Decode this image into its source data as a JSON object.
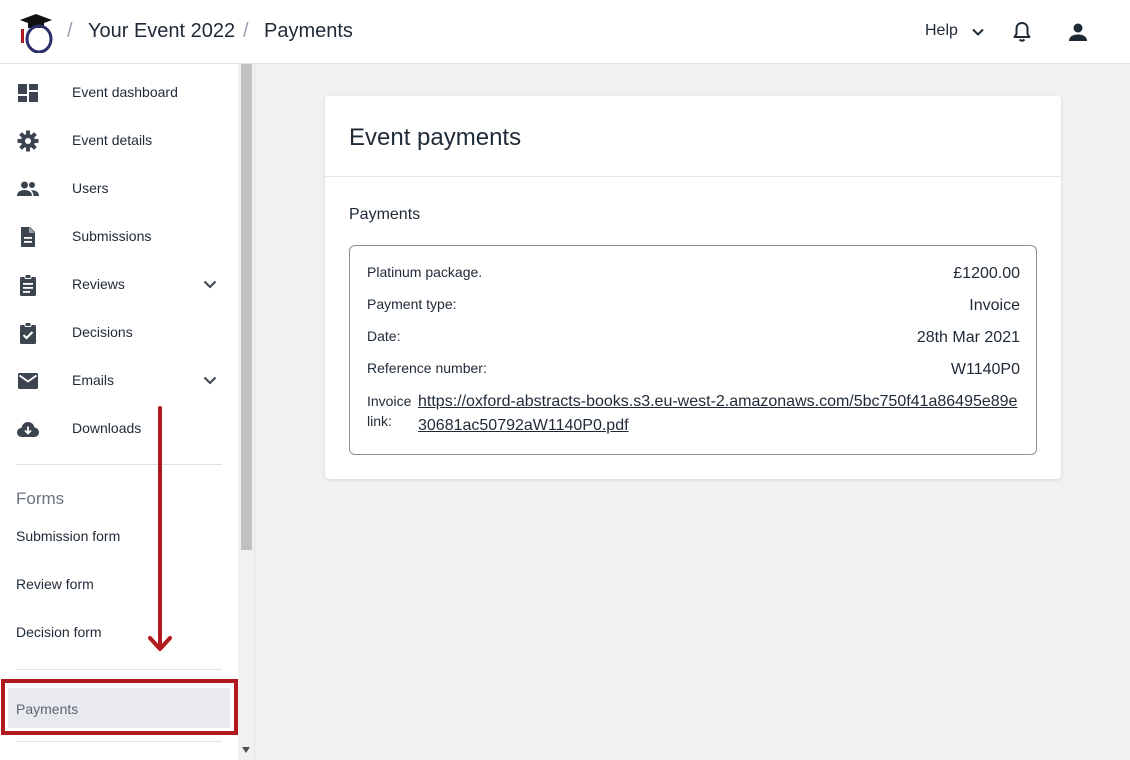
{
  "header": {
    "breadcrumb": [
      "Your Event 2022",
      "Payments"
    ],
    "help_label": "Help"
  },
  "sidebar": {
    "items": [
      {
        "label": "Event dashboard",
        "icon": "dashboard-icon"
      },
      {
        "label": "Event details",
        "icon": "gear-icon"
      },
      {
        "label": "Users",
        "icon": "users-icon"
      },
      {
        "label": "Submissions",
        "icon": "document-icon"
      },
      {
        "label": "Reviews",
        "icon": "clipboard-icon",
        "expandable": true
      },
      {
        "label": "Decisions",
        "icon": "clipboard-check-icon"
      },
      {
        "label": "Emails",
        "icon": "mail-icon",
        "expandable": true
      },
      {
        "label": "Downloads",
        "icon": "cloud-download-icon"
      }
    ],
    "forms_heading": "Forms",
    "forms": [
      "Submission form",
      "Review form",
      "Decision form"
    ],
    "active_item": "Payments"
  },
  "main": {
    "card_title": "Event payments",
    "section_title": "Payments",
    "payment": {
      "package_label": "Platinum package.",
      "package_value": "£1200.00",
      "type_label": "Payment type:",
      "type_value": "Invoice",
      "date_label": "Date:",
      "date_value": "28th Mar 2021",
      "ref_label": "Reference number:",
      "ref_value": "W1140P0",
      "link_label": "Invoice link:",
      "link_value": "https://oxford-abstracts-books.s3.eu-west-2.amazonaws.com/5bc750f41a86495e89e30681ac50792aW1140P0.pdf"
    }
  },
  "colors": {
    "annotation_red": "#b0191e",
    "logo_navy": "#2b2f6b",
    "active_bg": "#e8eaee"
  }
}
